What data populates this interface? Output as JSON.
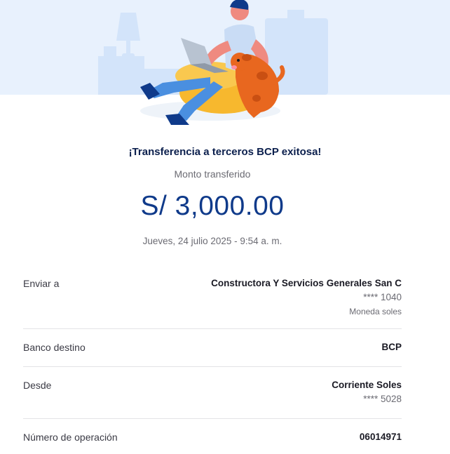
{
  "header": {
    "title": "¡Transferencia a terceros BCP exitosa!",
    "amount_label": "Monto transferido",
    "amount": "S/ 3,000.00",
    "date": "Jueves, 24 julio 2025 - 9:54 a. m."
  },
  "details": {
    "recipient": {
      "label": "Enviar a",
      "name": "Constructora Y Servicios Generales San C",
      "account": "**** 1040",
      "currency": "Moneda soles"
    },
    "bank": {
      "label": "Banco destino",
      "value": "BCP"
    },
    "origin": {
      "label": "Desde",
      "account_type": "Corriente Soles",
      "account": "**** 5028"
    },
    "operation": {
      "label": "Número de operación",
      "value": "06014971"
    }
  },
  "colors": {
    "brand_blue": "#0f3a8a",
    "hero_background": "#e8f1fd"
  },
  "icons": {
    "illustration": "person-with-laptop-and-dog-illustration"
  }
}
